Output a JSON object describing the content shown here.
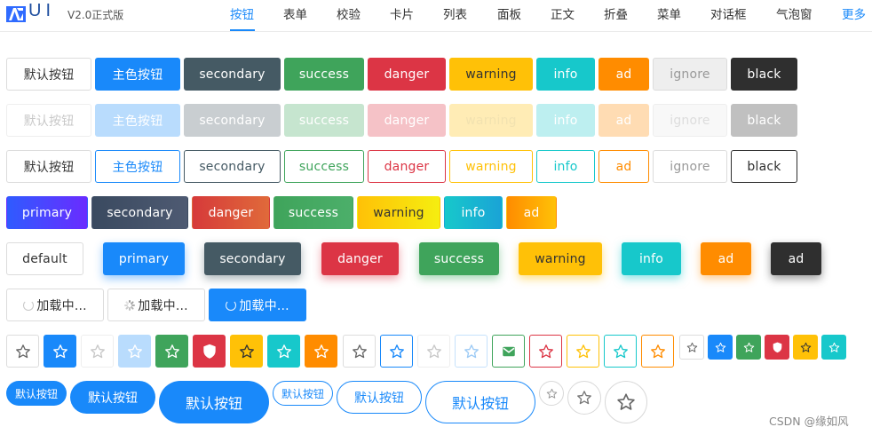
{
  "header": {
    "logo_text": "UI",
    "version": "V2.0正式版",
    "nav": [
      "按钮",
      "表单",
      "校验",
      "卡片",
      "列表",
      "面板",
      "正文",
      "折叠",
      "菜单",
      "对话框",
      "气泡窗",
      "更多"
    ],
    "active_index": 0
  },
  "colors": {
    "default": "#ffffff",
    "primary": "#1989fa",
    "secondary": "#455a64",
    "success": "#3fa45b",
    "danger": "#dc3545",
    "warning": "#ffc107",
    "info": "#17c8cb",
    "ad": "#ff8c00",
    "ignore": "#eeeeee",
    "black": "#2f2f2f"
  },
  "rows": {
    "solid": [
      "默认按钮",
      "主色按钮",
      "secondary",
      "success",
      "danger",
      "warning",
      "info",
      "ad",
      "ignore",
      "black"
    ],
    "disabled": [
      "默认按钮",
      "主色按钮",
      "secondary",
      "success",
      "danger",
      "warning",
      "info",
      "ad",
      "ignore",
      "black"
    ],
    "outline": [
      "默认按钮",
      "主色按钮",
      "secondary",
      "success",
      "danger",
      "warning",
      "info",
      "ad",
      "ignore",
      "black"
    ],
    "gradient": [
      "primary",
      "secondary",
      "danger",
      "success",
      "warning",
      "info",
      "ad"
    ],
    "shadow": [
      "default",
      "primary",
      "secondary",
      "danger",
      "success",
      "warning",
      "info",
      "ad",
      "ad"
    ],
    "loading": [
      "加载中...",
      "加载中...",
      "加载中..."
    ]
  },
  "icon_row": {
    "icons": [
      "star-icon",
      "star-icon",
      "star-icon",
      "star-icon",
      "star-icon",
      "shield-icon",
      "star-icon",
      "star-icon",
      "star-icon",
      "star-icon",
      "star-icon",
      "star-icon",
      "star-icon",
      "mail-icon",
      "star-icon",
      "star-icon",
      "star-icon",
      "star-icon",
      "star-icon",
      "star-icon",
      "star-icon",
      "shield-icon",
      "star-icon",
      "star-icon"
    ]
  },
  "round_row": {
    "labels": [
      "默认按钮",
      "默认按钮",
      "默认按钮",
      "默认按钮",
      "默认按钮",
      "默认按钮"
    ]
  },
  "watermark": "CSDN @缘如风"
}
